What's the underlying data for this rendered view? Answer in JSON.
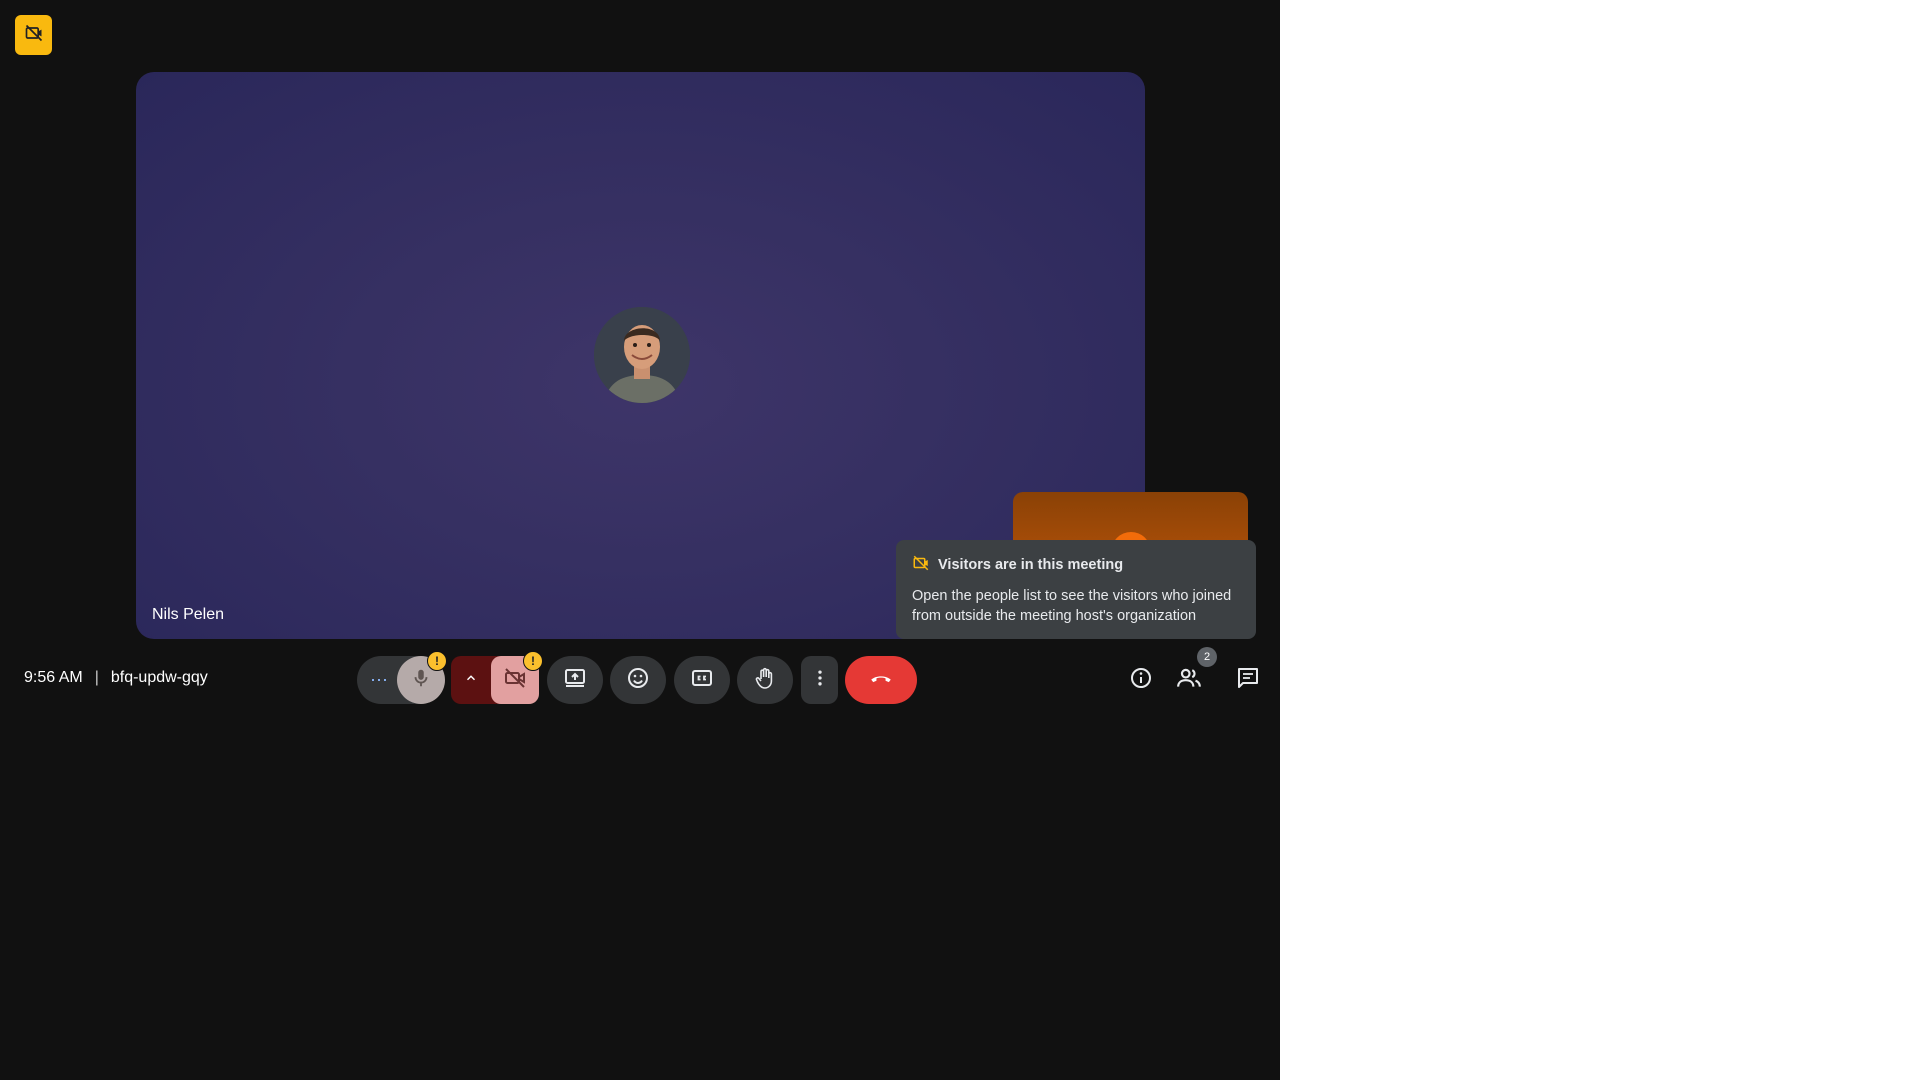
{
  "participant": {
    "name": "Nils Pelen"
  },
  "popup": {
    "title": "Visitors are in this meeting",
    "body": "Open the people list to see the visitors who joined from outside the meeting host's organization"
  },
  "meeting": {
    "time": "9:56 AM",
    "separator": "|",
    "code": "bfq-updw-gqy"
  },
  "controls": {
    "more_options_label": "⋯",
    "warning_mark": "!",
    "icons": [
      "microphone-icon",
      "chevron-up-icon",
      "camera-off-icon",
      "present-screen-icon",
      "emoji-icon",
      "captions-icon",
      "raise-hand-icon",
      "more-vert-icon",
      "end-call-icon"
    ]
  },
  "right_controls": {
    "people_count": "2",
    "icons": [
      "info-icon",
      "people-icon",
      "chat-icon"
    ]
  },
  "colors": {
    "background": "#111111",
    "accent_yellow": "#f9b90f",
    "end_call": "#e53935",
    "camera_off": "#5c1111"
  }
}
